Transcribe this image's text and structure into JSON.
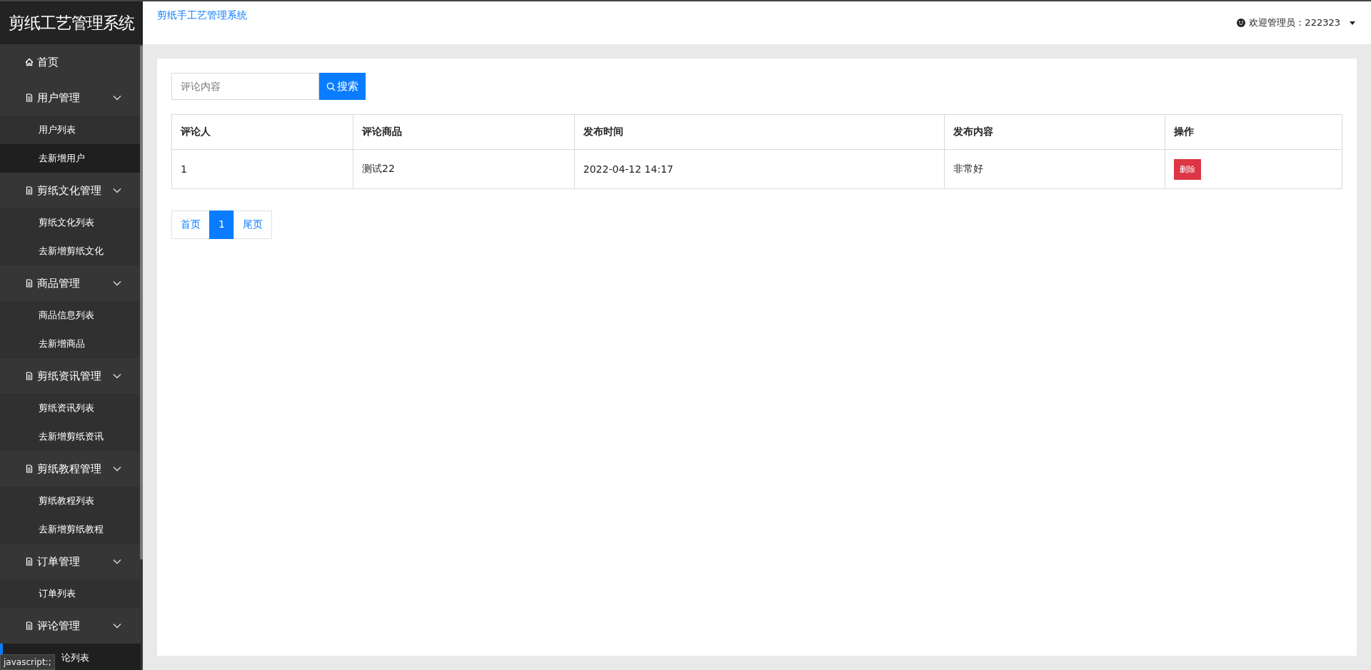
{
  "sidebar": {
    "logo": "剪纸工艺管理系统",
    "items": [
      {
        "kind": "link",
        "label": "首页",
        "selected": false
      },
      {
        "kind": "group",
        "label": "用户管理",
        "expanded": true,
        "children": [
          {
            "label": "用户列表",
            "selected": false
          },
          {
            "label": "去新增用户",
            "selected": true
          }
        ]
      },
      {
        "kind": "group",
        "label": "剪纸文化管理",
        "expanded": true,
        "children": [
          {
            "label": "剪纸文化列表",
            "selected": false
          },
          {
            "label": "去新增剪纸文化",
            "selected": false
          }
        ]
      },
      {
        "kind": "group",
        "label": "商品管理",
        "expanded": true,
        "children": [
          {
            "label": "商品信息列表",
            "selected": false
          },
          {
            "label": "去新增商品",
            "selected": false
          }
        ]
      },
      {
        "kind": "group",
        "label": "剪纸资讯管理",
        "expanded": true,
        "children": [
          {
            "label": "剪纸资讯列表",
            "selected": false
          },
          {
            "label": "去新增剪纸资讯",
            "selected": false
          }
        ]
      },
      {
        "kind": "group",
        "label": "剪纸教程管理",
        "expanded": true,
        "children": [
          {
            "label": "剪纸教程列表",
            "selected": false
          },
          {
            "label": "去新增剪纸教程",
            "selected": false
          }
        ]
      },
      {
        "kind": "group",
        "label": "订单管理",
        "expanded": true,
        "children": [
          {
            "label": "订单列表",
            "selected": false
          }
        ]
      },
      {
        "kind": "group",
        "label": "评论管理",
        "expanded": true,
        "children": [
          {
            "label": "论列表",
            "selected": true
          }
        ]
      }
    ],
    "status_tooltip": "javascript:;"
  },
  "header": {
    "title": "剪纸手工艺管理系统",
    "user": "欢迎管理员：222323"
  },
  "search": {
    "placeholder": "评论内容",
    "button": "搜索"
  },
  "table": {
    "columns": [
      "评论人",
      "评论商品",
      "发布时间",
      "发布内容",
      "操作"
    ],
    "rows": [
      {
        "cells": [
          "1",
          "测试22",
          "2022-04-12 14:17",
          "非常好"
        ],
        "action": "删除"
      }
    ]
  },
  "pagination": {
    "first": "首页",
    "pages": [
      {
        "label": "1",
        "selected": true
      }
    ],
    "last": "尾页"
  }
}
